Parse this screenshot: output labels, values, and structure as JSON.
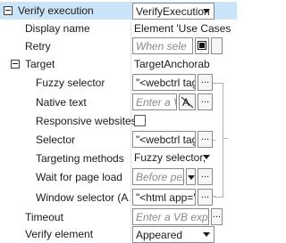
{
  "properties": {
    "verify_execution": {
      "label": "Verify execution",
      "value": "VerifyExecution"
    },
    "display_name": {
      "label": "Display name",
      "value": "Element 'Use Cases"
    },
    "retry": {
      "label": "Retry",
      "placeholder": "When sele"
    },
    "target": {
      "label": "Target",
      "value": "TargetAnchorab"
    },
    "fuzzy_selector": {
      "label": "Fuzzy selector",
      "value": "\"<webctrl tag",
      "button": "..."
    },
    "native_text": {
      "label": "Native text",
      "placeholder": "Enter a VE",
      "button": "..."
    },
    "responsive_websites": {
      "label": "Responsive websites"
    },
    "selector": {
      "label": "Selector",
      "value": "\"<webctrl tag",
      "button": "..."
    },
    "targeting_methods": {
      "label": "Targeting methods",
      "value": "Fuzzy selector,"
    },
    "wait_for_page_load": {
      "label": "Wait for page load",
      "placeholder": "Before per",
      "button": "..."
    },
    "window_selector": {
      "label": "Window selector (A...",
      "value": "\"<html app='",
      "button": "..."
    },
    "timeout": {
      "label": "Timeout",
      "placeholder": "Enter a VB exp",
      "button": "..."
    },
    "verify_element": {
      "label": "Verify element",
      "value": "Appeared"
    }
  },
  "icons": {
    "expand": "collapse-box-icon",
    "native_text_icon": "text-cursor-strike-icon",
    "retry_icon": "retry-swatch-icon",
    "dropdown": "chevron-down-icon"
  },
  "colors": {
    "selection": "#cce4f7",
    "border": "#8a8a8a",
    "placeholder": "#8a8a8a"
  }
}
